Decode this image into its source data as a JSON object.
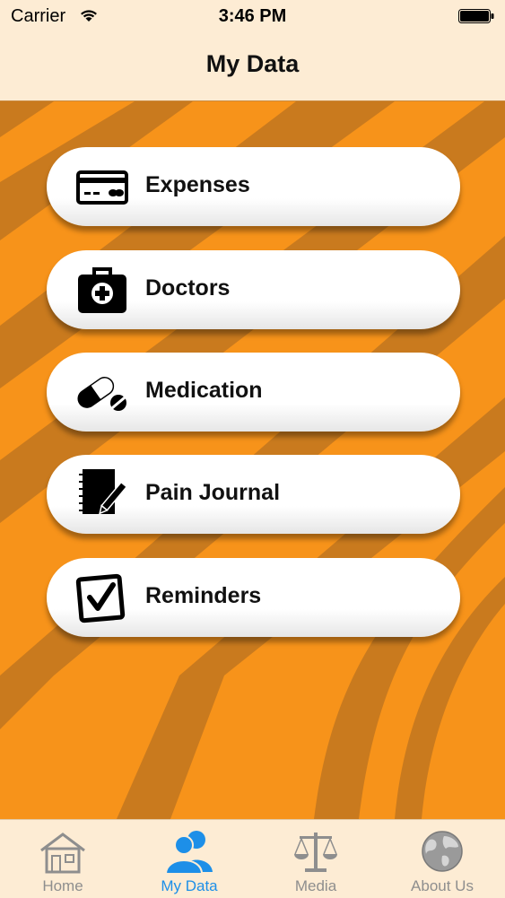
{
  "status_bar": {
    "carrier": "Carrier",
    "time": "3:46 PM"
  },
  "nav": {
    "title": "My Data"
  },
  "menu": {
    "items": [
      {
        "label": "Expenses",
        "icon": "credit-card-icon"
      },
      {
        "label": "Doctors",
        "icon": "medical-bag-icon"
      },
      {
        "label": "Medication",
        "icon": "pills-icon"
      },
      {
        "label": "Pain Journal",
        "icon": "notebook-pencil-icon"
      },
      {
        "label": "Reminders",
        "icon": "checkbox-icon"
      }
    ]
  },
  "tabs": {
    "items": [
      {
        "label": "Home",
        "icon": "house-icon"
      },
      {
        "label": "My Data",
        "icon": "people-icon",
        "active": true
      },
      {
        "label": "Media",
        "icon": "scales-icon"
      },
      {
        "label": "About Us",
        "icon": "globe-icon"
      }
    ]
  },
  "colors": {
    "accent": "#1d8fe8",
    "background": "#f7931a",
    "stripe": "#c97a1e",
    "bar": "#fdecd4"
  }
}
